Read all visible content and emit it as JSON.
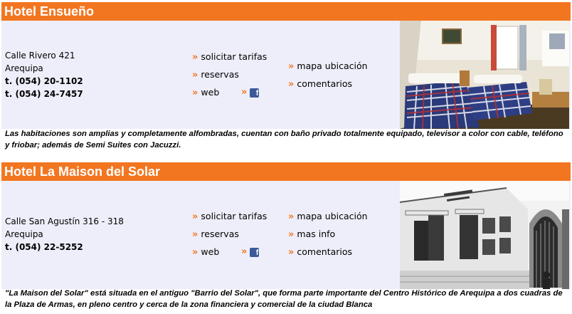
{
  "hotels": [
    {
      "name": "Hotel Ensueño",
      "address_line1": "Calle Rivero 421",
      "address_line2": "Arequipa",
      "phone1": "t. (054) 20-1102",
      "phone2": "t. (054) 24-7457",
      "links_col1": [
        "solicitar tarifas",
        "reservas",
        "web"
      ],
      "links_col2": [
        "mapa ubicación",
        "comentarios"
      ],
      "description": "Las habitaciones son amplias y completamente alfombradas, cuentan con baño privado totalmente equipado, televisor a color con cable, teléfono y friobar; además de Semi Suites con Jacuzzi."
    },
    {
      "name": "Hotel La Maison del Solar",
      "address_line1": "Calle San Agustín 316 - 318",
      "address_line2": "Arequipa",
      "phone1": "t. (054) 22-5252",
      "links_col1": [
        "solicitar tarifas",
        "reservas",
        "web"
      ],
      "links_col2": [
        "mapa ubicación",
        "mas info",
        "comentarios"
      ],
      "description": "\"La Maison del Solar\" está situada en el antiguo \"Barrio del Solar\", que forma parte importante del Centro Histórico de Arequipa a dos cuadras de la Plaza de Armas, en pleno centro y cerca de la zona financiera y comercial de la ciudad Blanca"
    }
  ],
  "icons": {
    "arrow": "»",
    "facebook": "f"
  },
  "colors": {
    "brand_orange": "#f27620",
    "card_background": "#eeeefa",
    "facebook_blue": "#3b5998"
  }
}
